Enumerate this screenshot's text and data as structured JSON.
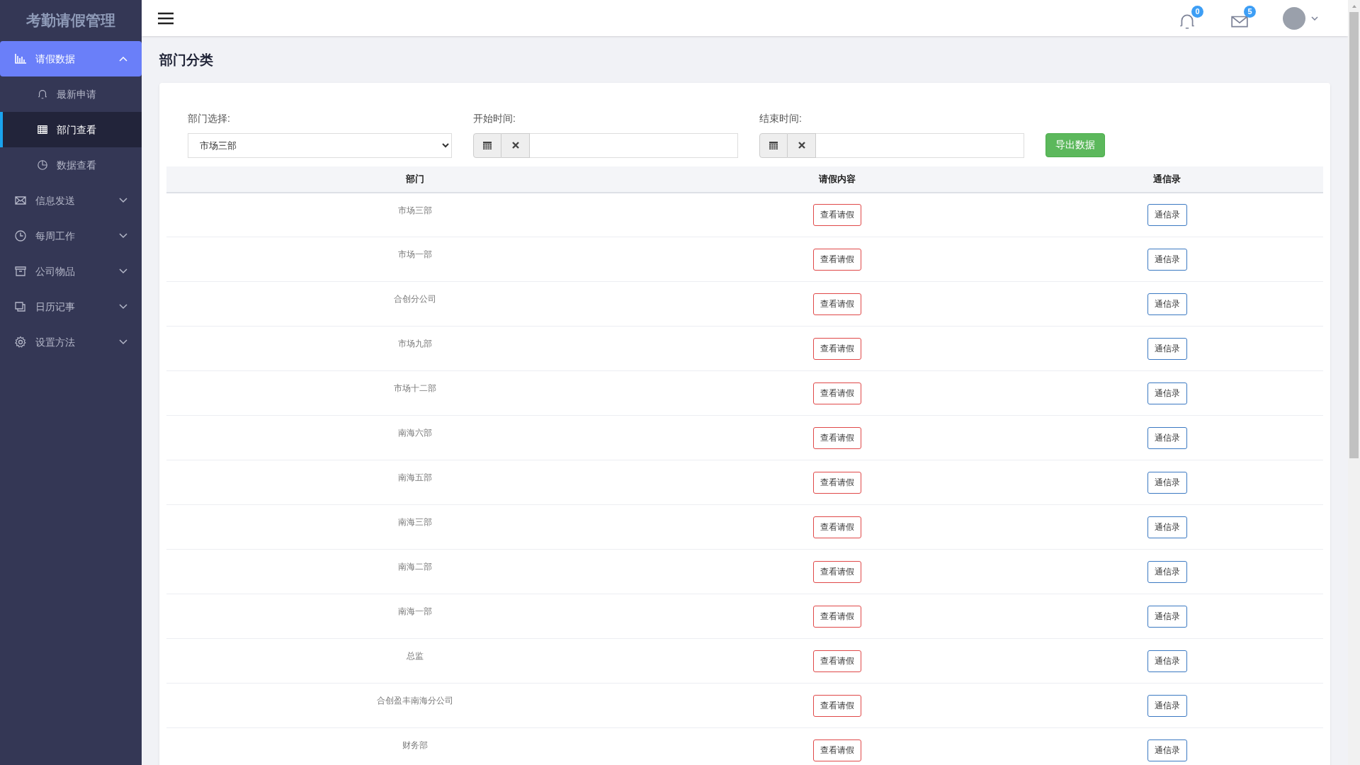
{
  "sidebar": {
    "title": "考勤请假管理",
    "items": [
      {
        "label": "请假数据",
        "expanded": true,
        "selected": true,
        "children": [
          {
            "label": "最新申请",
            "selected": false
          },
          {
            "label": "部门查看",
            "selected": true
          },
          {
            "label": "数据查看",
            "selected": false
          }
        ]
      },
      {
        "label": "信息发送",
        "expanded": false,
        "selected": false
      },
      {
        "label": "每周工作",
        "expanded": false,
        "selected": false
      },
      {
        "label": "公司物品",
        "expanded": false,
        "selected": false
      },
      {
        "label": "日历记事",
        "expanded": false,
        "selected": false
      },
      {
        "label": "设置方法",
        "expanded": false,
        "selected": false
      }
    ]
  },
  "header": {
    "notifications": "0",
    "messages": "5"
  },
  "page_title": "部门分类",
  "filters": {
    "department": {
      "label": "部门选择:",
      "value": "市场三部"
    },
    "start": {
      "label": "开始时间:"
    },
    "end": {
      "label": "结束时间:"
    },
    "export_button": "导出数据"
  },
  "table": {
    "columns": [
      "部门",
      "请假内容",
      "通信录"
    ],
    "rows": [
      {
        "department": "市场三部",
        "leave": "查看请假",
        "contacts": "通信录"
      },
      {
        "department": "市场一部",
        "leave": "查看请假",
        "contacts": "通信录"
      },
      {
        "department": "合创分公司",
        "leave": "查看请假",
        "contacts": "通信录"
      },
      {
        "department": "市场九部",
        "leave": "查看请假",
        "contacts": "通信录"
      },
      {
        "department": "市场十二部",
        "leave": "查看请假",
        "contacts": "通信录"
      },
      {
        "department": "南海六部",
        "leave": "查看请假",
        "contacts": "通信录"
      },
      {
        "department": "南海五部",
        "leave": "查看请假",
        "contacts": "通信录"
      },
      {
        "department": "南海三部",
        "leave": "查看请假",
        "contacts": "通信录"
      },
      {
        "department": "南海二部",
        "leave": "查看请假",
        "contacts": "通信录"
      },
      {
        "department": "南海一部",
        "leave": "查看请假",
        "contacts": "通信录"
      },
      {
        "department": "总监",
        "leave": "查看请假",
        "contacts": "通信录"
      },
      {
        "department": "合创盈丰南海分公司",
        "leave": "查看请假",
        "contacts": "通信录"
      },
      {
        "department": "财务部",
        "leave": "查看请假",
        "contacts": "通信录"
      }
    ]
  }
}
